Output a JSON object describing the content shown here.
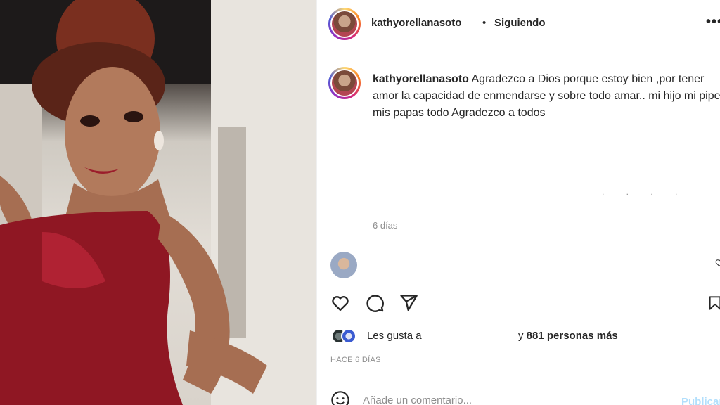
{
  "post": {
    "username": "kathyorellanasoto",
    "separator": "•",
    "follow_label": "Siguiendo",
    "more_label": "•••"
  },
  "caption": {
    "username": "kathyorellanasoto",
    "text": "Agradezco a Dios porque estoy bien ,por tener amor la capacidad de enmendarse y sobre todo amar.. mi hijo mi pipe mis papas todo Agradezco a todos",
    "specks": ". . . .",
    "time": "6 días"
  },
  "likes": {
    "prefix": "Les gusta a",
    "suffix": "y",
    "count": "881 personas más"
  },
  "date": "HACE 6 DÍAS",
  "add_comment": {
    "placeholder": "Añade un comentario...",
    "publish_label": "Publicar"
  },
  "icons": {
    "like": "heart-icon",
    "comment": "comment-icon",
    "share": "send-icon",
    "save": "bookmark-icon",
    "emoji": "emoji-icon",
    "more": "more-options-icon"
  },
  "colors": {
    "text": "#262626",
    "secondary": "#8e8e8e",
    "divider": "#efefef",
    "publish_disabled": "#b2dffc"
  }
}
